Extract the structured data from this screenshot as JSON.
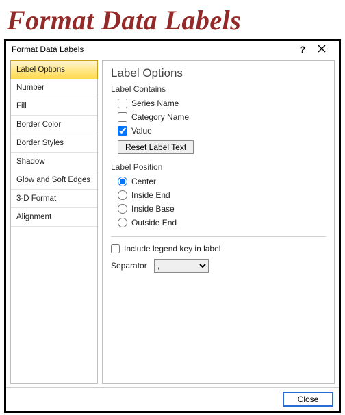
{
  "banner": "Format Data Labels",
  "dialog": {
    "title": "Format Data Labels",
    "help_symbol": "?",
    "close_label": "Close"
  },
  "sidebar": {
    "items": [
      {
        "label": "Label Options",
        "selected": true
      },
      {
        "label": "Number",
        "selected": false
      },
      {
        "label": "Fill",
        "selected": false
      },
      {
        "label": "Border Color",
        "selected": false
      },
      {
        "label": "Border Styles",
        "selected": false
      },
      {
        "label": "Shadow",
        "selected": false
      },
      {
        "label": "Glow and Soft Edges",
        "selected": false
      },
      {
        "label": "3-D Format",
        "selected": false
      },
      {
        "label": "Alignment",
        "selected": false
      }
    ]
  },
  "main": {
    "heading": "Label Options",
    "contains_label": "Label Contains",
    "contains": [
      {
        "label": "Series Name",
        "checked": false
      },
      {
        "label": "Category Name",
        "checked": false
      },
      {
        "label": "Value",
        "checked": true
      }
    ],
    "reset_label": "Reset Label Text",
    "position_label": "Label Position",
    "position": [
      {
        "label": "Center",
        "checked": true
      },
      {
        "label": "Inside End",
        "checked": false
      },
      {
        "label": "Inside Base",
        "checked": false
      },
      {
        "label": "Outside End",
        "checked": false
      }
    ],
    "include_legend_label": "Include legend key in label",
    "include_legend_checked": false,
    "separator_label": "Separator",
    "separator_value": ","
  }
}
